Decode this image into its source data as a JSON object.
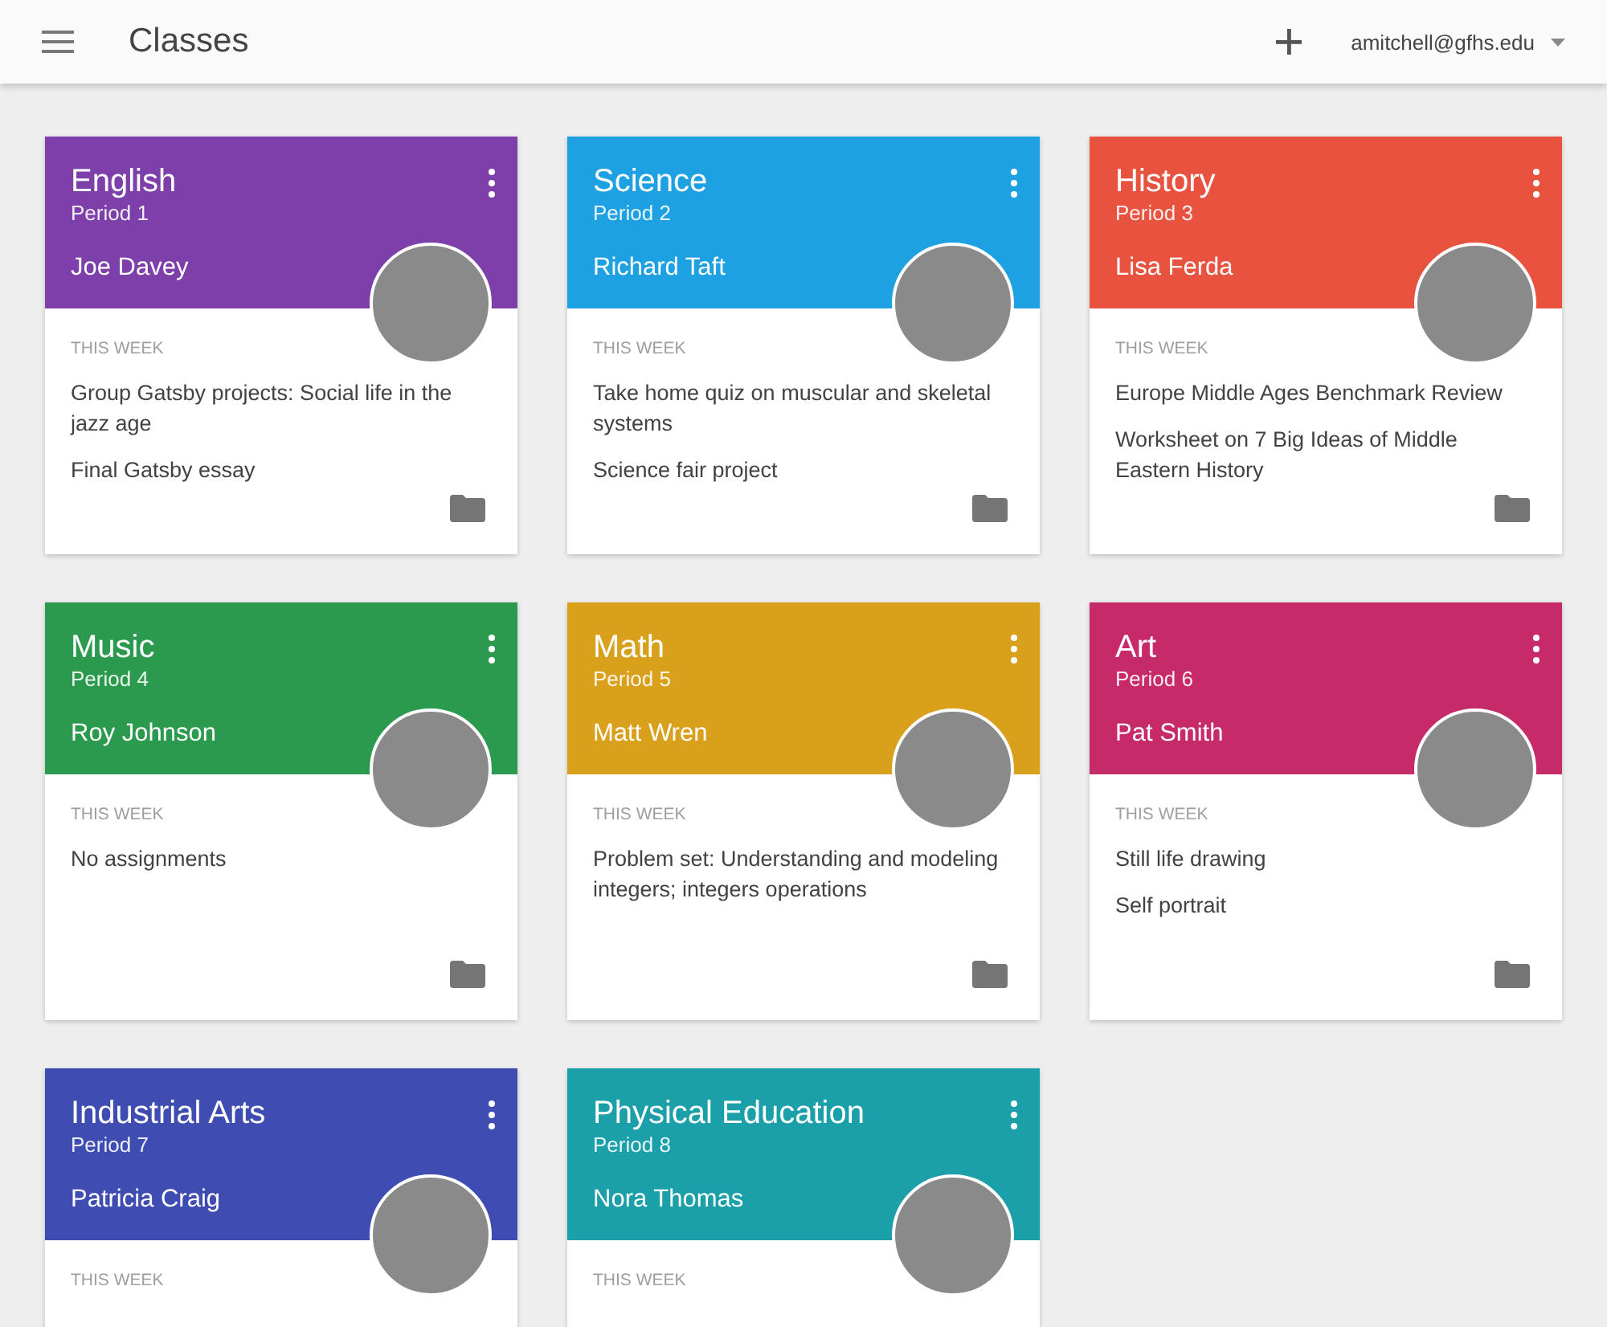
{
  "app_bar": {
    "title": "Classes",
    "account": "amitchell@gfhs.edu"
  },
  "classes": [
    {
      "name": "English",
      "period": "Period 1",
      "teacher": "Joe Davey",
      "color": "#7d3fa9",
      "section_label": "THIS WEEK",
      "items": [
        "Group Gatsby projects: Social life in the jazz age",
        "Final Gatsby essay"
      ]
    },
    {
      "name": "Science",
      "period": "Period 2",
      "teacher": "Richard Taft",
      "color": "#1da1e2",
      "section_label": "THIS WEEK",
      "items": [
        "Take home quiz on muscular and skeletal systems",
        "Science fair project"
      ]
    },
    {
      "name": "History",
      "period": "Period 3",
      "teacher": "Lisa Ferda",
      "color": "#e8533f",
      "section_label": "THIS WEEK",
      "items": [
        "Europe Middle Ages Benchmark Review",
        "Worksheet on 7 Big Ideas of Middle Eastern History"
      ]
    },
    {
      "name": "Music",
      "period": "Period 4",
      "teacher": "Roy Johnson",
      "color": "#2b9a4e",
      "section_label": "THIS WEEK",
      "items": [
        "No assignments"
      ]
    },
    {
      "name": "Math",
      "period": "Period 5",
      "teacher": "Matt Wren",
      "color": "#d9a01b",
      "section_label": "THIS WEEK",
      "items": [
        "Problem set: Understanding and modeling integers; integers operations"
      ]
    },
    {
      "name": "Art",
      "period": "Period 6",
      "teacher": "Pat Smith",
      "color": "#c62a68",
      "section_label": "THIS WEEK",
      "items": [
        "Still life drawing",
        "Self portrait"
      ]
    },
    {
      "name": "Industrial Arts",
      "period": "Period 7",
      "teacher": "Patricia Craig",
      "color": "#3f4db3",
      "section_label": "THIS WEEK"
    },
    {
      "name": "Physical Education",
      "period": "Period 8",
      "teacher": "Nora Thomas",
      "color": "#1b9fa9",
      "section_label": "THIS WEEK"
    }
  ]
}
